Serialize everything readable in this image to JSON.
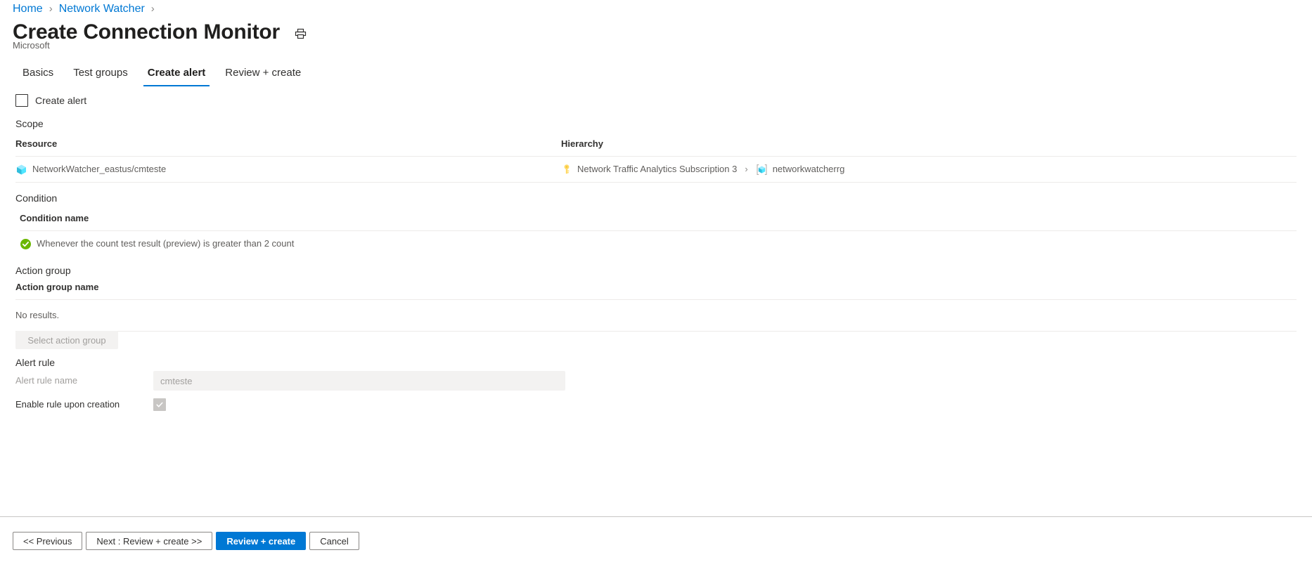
{
  "breadcrumb": {
    "items": [
      {
        "label": "Home"
      },
      {
        "label": "Network Watcher"
      }
    ],
    "separator": "›"
  },
  "header": {
    "title": "Create Connection Monitor",
    "subtitle": "Microsoft",
    "print_icon": "print-icon"
  },
  "tabs": [
    {
      "label": "Basics",
      "active": false
    },
    {
      "label": "Test groups",
      "active": false
    },
    {
      "label": "Create alert",
      "active": true
    },
    {
      "label": "Review + create",
      "active": false
    }
  ],
  "create_alert": {
    "label": "Create alert",
    "checked": false
  },
  "scope": {
    "section_label": "Scope",
    "columns": [
      "Resource",
      "Hierarchy"
    ],
    "row": {
      "resource_icon": "azure-resource-cube-icon",
      "resource": "NetworkWatcher_eastus/cmteste",
      "subscription_icon": "key-icon",
      "subscription": "Network Traffic Analytics Subscription 3",
      "hierarchy_separator": "›",
      "resource_group_icon": "resource-group-icon",
      "resource_group": "networkwatcherrg"
    }
  },
  "condition": {
    "section_label": "Condition",
    "column": "Condition name",
    "status_icon": "success-check-icon",
    "text": "Whenever the count test result (preview) is greater than 2 count"
  },
  "action_group": {
    "section_label": "Action group",
    "column": "Action group name",
    "empty_text": "No results.",
    "select_button": "Select action group"
  },
  "alert_rule": {
    "section_label": "Alert rule",
    "name_label": "Alert rule name",
    "name_value": "cmteste",
    "name_placeholder": "cmteste",
    "enable_label": "Enable rule upon creation",
    "enable_checked": true
  },
  "footer": {
    "buttons": [
      {
        "label": "<< Previous",
        "primary": false
      },
      {
        "label": "Next : Review + create >>",
        "primary": false
      },
      {
        "label": "Review + create",
        "primary": true
      },
      {
        "label": "Cancel",
        "primary": false
      }
    ]
  },
  "colors": {
    "accent": "#0078d4",
    "link": "#0078d4",
    "success": "#6bb700",
    "resource_cube": "#50e6ff",
    "key_yellow": "#ffd966",
    "text": "#323130",
    "muted": "#605e5c",
    "disabled": "#a19f9d"
  }
}
